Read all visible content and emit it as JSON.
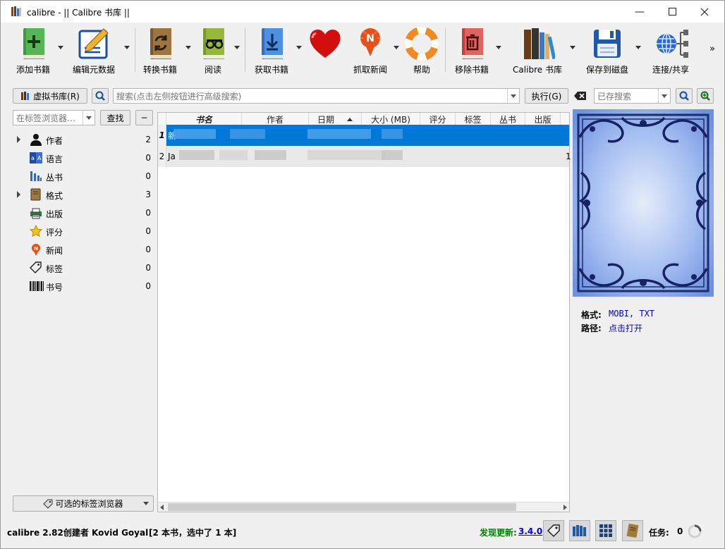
{
  "window": {
    "title": "calibre - || Calibre 书库 ||"
  },
  "toolbar": {
    "add_books": "添加书籍",
    "edit_metadata": "编辑元数据",
    "convert_books": "转换书籍",
    "read": "阅读",
    "get_books": "获取书籍",
    "fetch_news": "抓取新闻",
    "help": "帮助",
    "remove_books": "移除书籍",
    "calibre_library": "Calibre 书库",
    "save_to_disk": "保存到磁盘",
    "connect_share": "连接/共享",
    "more": "»"
  },
  "search": {
    "virtual_library": "虚拟书库(R)",
    "placeholder": "搜索(点击左侧按钮进行高级搜索)",
    "execute": "执行(G)",
    "saved_search_placeholder": "已存搜索"
  },
  "tag_browser": {
    "find_placeholder": "在标签浏览器…",
    "find_button": "查找",
    "collapse_button": "−",
    "items": [
      {
        "label": "作者",
        "count": "2",
        "icon": "person-icon",
        "expandable": true
      },
      {
        "label": "语言",
        "count": "0",
        "icon": "language-icon",
        "expandable": false
      },
      {
        "label": "丛书",
        "count": "0",
        "icon": "series-icon",
        "expandable": false
      },
      {
        "label": "格式",
        "count": "3",
        "icon": "book-icon",
        "expandable": true
      },
      {
        "label": "出版",
        "count": "0",
        "icon": "printer-icon",
        "expandable": false
      },
      {
        "label": "评分",
        "count": "0",
        "icon": "star-icon",
        "expandable": false
      },
      {
        "label": "新闻",
        "count": "0",
        "icon": "news-icon",
        "expandable": false
      },
      {
        "label": "标签",
        "count": "0",
        "icon": "tag-icon",
        "expandable": false
      },
      {
        "label": "书号",
        "count": "0",
        "icon": "barcode-icon",
        "expandable": false
      }
    ],
    "bottom_button": "可选的标签浏览器"
  },
  "book_table": {
    "columns": [
      "书名",
      "作者",
      "日期",
      "大小 (MB)",
      "评分",
      "标签",
      "丛书",
      "出版"
    ],
    "rows": [
      {
        "num": "1",
        "title_visible": "新",
        "selected": true
      },
      {
        "num": "2",
        "title_visible": "Ja",
        "selected": false,
        "trailing": "1"
      }
    ]
  },
  "details": {
    "format_label": "格式:",
    "format_value": "MOBI, TXT",
    "path_label": "路径:",
    "path_value": "点击打开"
  },
  "status": {
    "app_info": "calibre 2.82创建者 Kovid Goyal",
    "selection": "[2 本书，选中了 1 本]",
    "update_label": "发现更新:",
    "update_version": "3.4.0",
    "tasks_label": "任务:",
    "tasks_count": "0"
  },
  "colors": {
    "selection": "#0078d7",
    "cover_blue": "#8fb0ee",
    "update_green": "#008000",
    "link_blue": "#0000ee"
  }
}
